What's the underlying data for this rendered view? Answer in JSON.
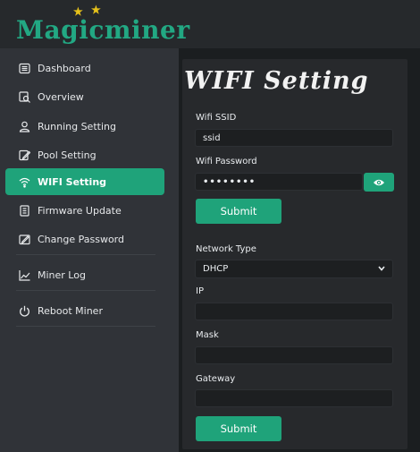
{
  "brand": {
    "logo_text": "Magicminer"
  },
  "sidebar": {
    "items": [
      {
        "label": "Dashboard",
        "icon": "dashboard-icon"
      },
      {
        "label": "Overview",
        "icon": "overview-icon"
      },
      {
        "label": "Running Setting",
        "icon": "user-icon"
      },
      {
        "label": "Pool Setting",
        "icon": "pool-icon"
      },
      {
        "label": "WIFI Setting",
        "icon": "wifi-icon",
        "active": true
      },
      {
        "label": "Firmware Update",
        "icon": "firmware-icon"
      },
      {
        "label": "Change Password",
        "icon": "password-icon"
      },
      {
        "label": "Miner Log",
        "icon": "chart-line-icon"
      },
      {
        "label": "Reboot Miner",
        "icon": "power-icon"
      }
    ]
  },
  "main": {
    "title": "WIFI Setting",
    "wifi": {
      "ssid_label": "Wifi SSID",
      "ssid_value": "ssid",
      "password_label": "Wifi Password",
      "password_value": "••••••••",
      "submit_label": "Submit"
    },
    "network": {
      "type_label": "Network Type",
      "type_value": "DHCP",
      "ip_label": "IP",
      "ip_value": "",
      "mask_label": "Mask",
      "mask_value": "",
      "gateway_label": "Gateway",
      "gateway_value": "",
      "submit_label": "Submit"
    }
  },
  "colors": {
    "accent": "#1fa37a",
    "logo": "#22a883",
    "star": "#e7c21a"
  }
}
